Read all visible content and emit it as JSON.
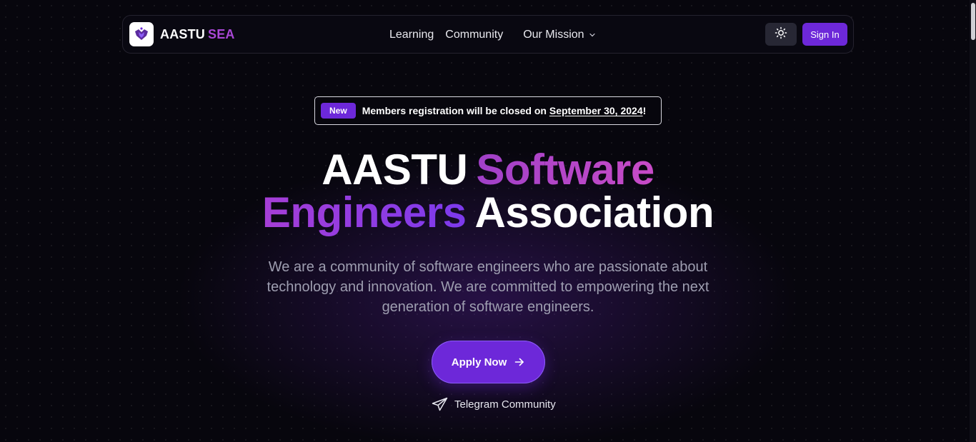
{
  "brand": {
    "name": "AASTU",
    "accent": "SEA",
    "logo_icon": "aastu-sea-logo-icon"
  },
  "nav": {
    "links": [
      "Learning",
      "Community",
      "Our Mission"
    ],
    "theme_icon": "sun-icon",
    "signin_label": "Sign In"
  },
  "announcement": {
    "badge": "New",
    "text": "Members registration will be closed on ",
    "date": "September 30, 2024",
    "suffix": "!"
  },
  "hero": {
    "line1_a": "AASTU",
    "line1_b": "Software",
    "line2_a": "Engineers",
    "line2_b": "Association",
    "description": "We are a community of software engineers who are passionate about technology and innovation. We are committed to empowering the next generation of software engineers.",
    "cta_label": "Apply Now",
    "cta_icon": "arrow-right-icon",
    "telegram_label": "Telegram Community",
    "telegram_icon": "telegram-send-icon"
  },
  "colors": {
    "primary": "#6d28d9",
    "accent_text": "#a947d6",
    "background": "#07060d"
  }
}
